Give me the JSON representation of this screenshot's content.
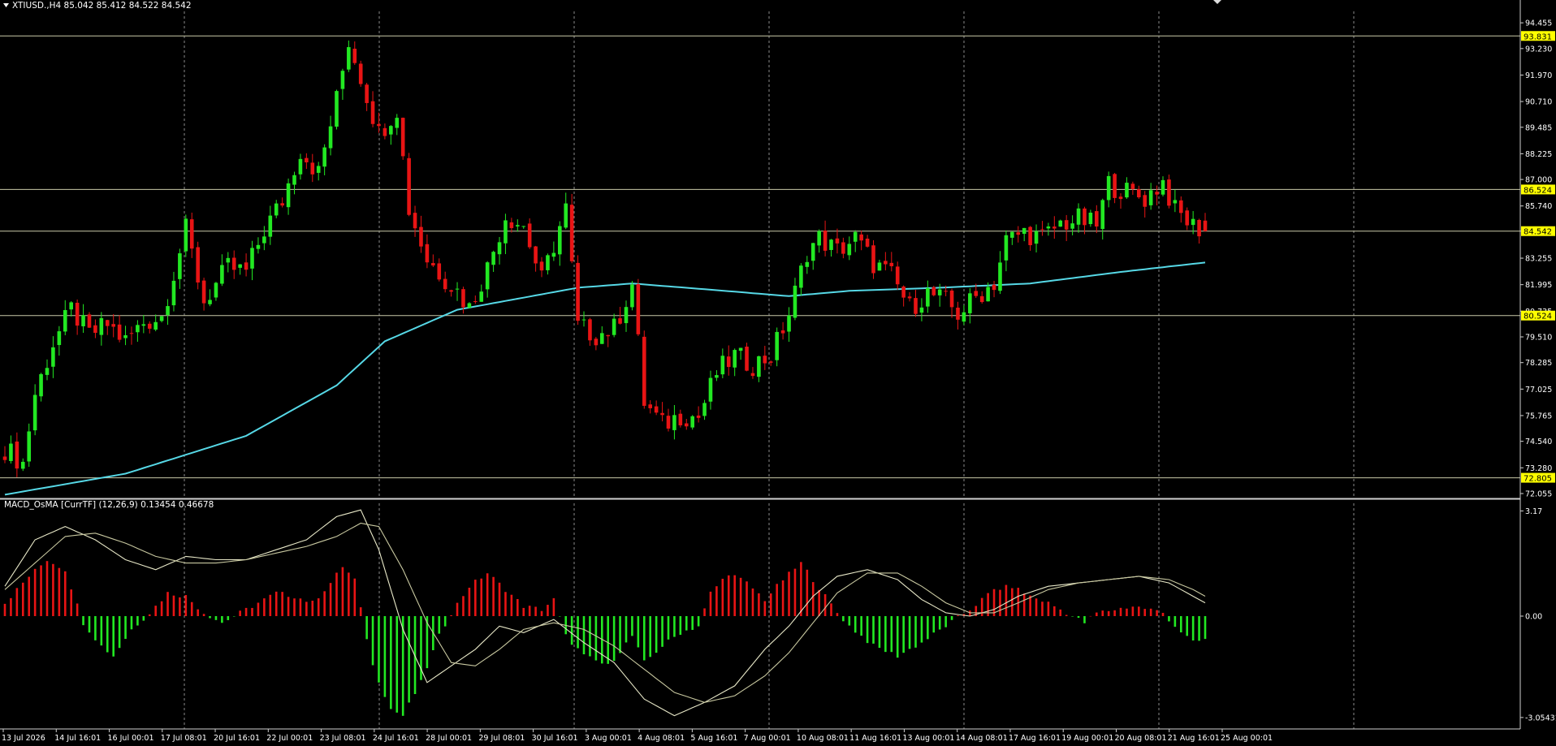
{
  "header": {
    "menu_icon": "dropdown-triangle-icon",
    "text": "XTIUSD.,H4  85.042 85.412 84.522 84.542"
  },
  "indicator": {
    "text": "MACD_OsMA [CurrTF] (12,26,9) 0.13454 0.46678"
  },
  "colors": {
    "background": "#000000",
    "bull": "#22e822",
    "bear": "#e81414",
    "ma": "#56d8e6",
    "hline": "#c9c9a8",
    "tag_bg": "#ffff00",
    "grid": "#8a8a8a",
    "macd_line": "#e8e8c8",
    "signal_line": "#c8c8a0"
  },
  "chart_data": [
    {
      "type": "candlestick",
      "symbol": "XTIUSD.",
      "timeframe": "H4",
      "ohlc_last": {
        "open": 85.042,
        "high": 85.412,
        "low": 84.522,
        "close": 84.542
      },
      "y_ticks": [
        "94.455",
        "93.230",
        "91.970",
        "90.710",
        "89.485",
        "88.225",
        "87.000",
        "85.740",
        "84.542",
        "83.255",
        "81.995",
        "80.735",
        "79.510",
        "78.285",
        "77.025",
        "75.765",
        "74.540",
        "73.280",
        "72.055"
      ],
      "ylim": [
        71.9,
        95.0
      ],
      "x_tick_labels": [
        "13 Jul 2026",
        "14 Jul 16:01",
        "16 Jul 00:01",
        "17 Jul 08:01",
        "20 Jul 16:01",
        "22 Jul 00:01",
        "23 Jul 08:01",
        "24 Jul 16:01",
        "28 Jul 00:01",
        "29 Jul 08:01",
        "30 Jul 16:01",
        "3 Aug 00:01",
        "4 Aug 08:01",
        "5 Aug 16:01",
        "7 Aug 00:01",
        "10 Aug 08:01",
        "11 Aug 16:01",
        "13 Aug 00:01",
        "14 Aug 08:01",
        "17 Aug 16:01",
        "19 Aug 00:01",
        "20 Aug 08:01",
        "21 Aug 16:01",
        "25 Aug 00:01"
      ],
      "horizontal_levels": [
        {
          "value": 93.831,
          "label": "93.831"
        },
        {
          "value": 86.524,
          "label": "86.524"
        },
        {
          "value": 84.542,
          "label": "84.542"
        },
        {
          "value": 80.524,
          "label": "80.524"
        },
        {
          "value": 72.805,
          "label": "72.805"
        }
      ],
      "close_path": [
        [
          0,
          74.2
        ],
        [
          3,
          73.5
        ],
        [
          5,
          76.8
        ],
        [
          8,
          79.2
        ],
        [
          11,
          80.8
        ],
        [
          14,
          79.6
        ],
        [
          17,
          80.1
        ],
        [
          20,
          79.3
        ],
        [
          23,
          80.2
        ],
        [
          26,
          80.5
        ],
        [
          30,
          84.6
        ],
        [
          33,
          81.2
        ],
        [
          37,
          82.8
        ],
        [
          40,
          82.6
        ],
        [
          43,
          84.6
        ],
        [
          46,
          86.0
        ],
        [
          49,
          88.4
        ],
        [
          52,
          87.3
        ],
        [
          55,
          90.8
        ],
        [
          57,
          93.6
        ],
        [
          59,
          91.9
        ],
        [
          62,
          89.2
        ],
        [
          65,
          90.4
        ],
        [
          67,
          85.6
        ],
        [
          70,
          83.2
        ],
        [
          73,
          82.3
        ],
        [
          75,
          81.7
        ],
        [
          77,
          80.9
        ],
        [
          80,
          82.8
        ],
        [
          83,
          85.3
        ],
        [
          86,
          84.8
        ],
        [
          89,
          82.2
        ],
        [
          93,
          85.6
        ],
        [
          95,
          80.0
        ],
        [
          98,
          79.6
        ],
        [
          101,
          79.9
        ],
        [
          104,
          82.0
        ],
        [
          106,
          76.4
        ],
        [
          109,
          75.3
        ],
        [
          112,
          75.8
        ],
        [
          115,
          75.7
        ],
        [
          118,
          77.8
        ],
        [
          121,
          78.6
        ],
        [
          124,
          78.2
        ],
        [
          127,
          78.6
        ],
        [
          130,
          80.6
        ],
        [
          133,
          83.6
        ],
        [
          135,
          84.2
        ],
        [
          138,
          83.6
        ],
        [
          141,
          84.2
        ],
        [
          144,
          83.0
        ],
        [
          147,
          82.4
        ],
        [
          150,
          80.9
        ],
        [
          153,
          81.6
        ],
        [
          156,
          81.2
        ],
        [
          158,
          80.6
        ],
        [
          161,
          81.4
        ],
        [
          164,
          82.1
        ],
        [
          166,
          84.1
        ],
        [
          169,
          84.5
        ],
        [
          172,
          84.2
        ],
        [
          175,
          84.9
        ],
        [
          178,
          85.1
        ],
        [
          181,
          84.8
        ],
        [
          183,
          86.8
        ],
        [
          186,
          86.4
        ],
        [
          189,
          86.1
        ],
        [
          192,
          86.9
        ],
        [
          194,
          85.5
        ],
        [
          197,
          84.8
        ],
        [
          199,
          84.542
        ]
      ],
      "ma_path": [
        [
          0,
          72.0
        ],
        [
          20,
          73.0
        ],
        [
          40,
          74.8
        ],
        [
          55,
          77.2
        ],
        [
          63,
          79.3
        ],
        [
          75,
          80.8
        ],
        [
          95,
          81.85
        ],
        [
          104,
          82.05
        ],
        [
          115,
          81.8
        ],
        [
          130,
          81.45
        ],
        [
          140,
          81.7
        ],
        [
          155,
          81.85
        ],
        [
          170,
          82.05
        ],
        [
          185,
          82.6
        ],
        [
          199,
          83.05
        ]
      ]
    },
    {
      "type": "bar",
      "name": "MACD_OsMA [CurrTF] (12,26,9)",
      "values_last": [
        0.13454,
        0.46678
      ],
      "y_ticks": [
        "3.17",
        "0.00",
        "-3.05431"
      ],
      "ylim": [
        -3.4,
        3.4
      ],
      "histogram_path": [
        [
          0,
          0.4
        ],
        [
          4,
          1.2
        ],
        [
          7,
          1.7
        ],
        [
          10,
          1.4
        ],
        [
          13,
          -0.2
        ],
        [
          16,
          -0.9
        ],
        [
          18,
          -1.2
        ],
        [
          21,
          -0.4
        ],
        [
          24,
          0.1
        ],
        [
          27,
          0.7
        ],
        [
          30,
          0.6
        ],
        [
          33,
          0.1
        ],
        [
          36,
          -0.2
        ],
        [
          39,
          0.1
        ],
        [
          42,
          0.4
        ],
        [
          45,
          0.7
        ],
        [
          48,
          0.6
        ],
        [
          51,
          0.4
        ],
        [
          54,
          1.0
        ],
        [
          56,
          1.5
        ],
        [
          58,
          1.1
        ],
        [
          59,
          0.2
        ],
        [
          61,
          -1.5
        ],
        [
          64,
          -2.8
        ],
        [
          66,
          -3.0
        ],
        [
          69,
          -2.0
        ],
        [
          72,
          -0.6
        ],
        [
          74,
          0.1
        ],
        [
          77,
          0.9
        ],
        [
          80,
          1.3
        ],
        [
          83,
          0.8
        ],
        [
          86,
          0.3
        ],
        [
          89,
          0.2
        ],
        [
          91,
          0.5
        ],
        [
          93,
          -0.6
        ],
        [
          96,
          -1.2
        ],
        [
          100,
          -1.5
        ],
        [
          104,
          -0.6
        ],
        [
          106,
          -1.4
        ],
        [
          109,
          -0.9
        ],
        [
          112,
          -0.5
        ],
        [
          115,
          -0.3
        ],
        [
          117,
          0.7
        ],
        [
          120,
          1.3
        ],
        [
          123,
          1.0
        ],
        [
          126,
          0.5
        ],
        [
          129,
          1.1
        ],
        [
          132,
          1.6
        ],
        [
          134,
          1.1
        ],
        [
          136,
          0.6
        ],
        [
          138,
          0.1
        ],
        [
          140,
          -0.3
        ],
        [
          144,
          -0.9
        ],
        [
          148,
          -1.2
        ],
        [
          152,
          -0.8
        ],
        [
          156,
          -0.3
        ],
        [
          160,
          0.2
        ],
        [
          164,
          0.8
        ],
        [
          167,
          0.9
        ],
        [
          170,
          0.6
        ],
        [
          173,
          0.4
        ],
        [
          176,
          0.1
        ],
        [
          179,
          -0.2
        ],
        [
          181,
          0.1
        ],
        [
          184,
          0.2
        ],
        [
          187,
          0.3
        ],
        [
          190,
          0.2
        ],
        [
          192,
          0.1
        ],
        [
          194,
          -0.3
        ],
        [
          197,
          -0.8
        ],
        [
          199,
          -0.7
        ]
      ],
      "macd_line_path": [
        [
          0,
          0.9
        ],
        [
          5,
          2.3
        ],
        [
          10,
          2.7
        ],
        [
          15,
          2.3
        ],
        [
          20,
          1.7
        ],
        [
          25,
          1.4
        ],
        [
          30,
          1.8
        ],
        [
          35,
          1.7
        ],
        [
          40,
          1.7
        ],
        [
          45,
          2.0
        ],
        [
          50,
          2.3
        ],
        [
          55,
          3.0
        ],
        [
          59,
          3.2
        ],
        [
          62,
          2.0
        ],
        [
          66,
          -0.4
        ],
        [
          70,
          -2.0
        ],
        [
          74,
          -1.5
        ],
        [
          78,
          -1.0
        ],
        [
          82,
          -0.3
        ],
        [
          86,
          -0.5
        ],
        [
          91,
          -0.1
        ],
        [
          96,
          -0.8
        ],
        [
          101,
          -1.4
        ],
        [
          106,
          -2.5
        ],
        [
          111,
          -3.0
        ],
        [
          116,
          -2.6
        ],
        [
          121,
          -2.1
        ],
        [
          126,
          -1.0
        ],
        [
          130,
          -0.3
        ],
        [
          134,
          0.6
        ],
        [
          138,
          1.2
        ],
        [
          143,
          1.4
        ],
        [
          148,
          1.1
        ],
        [
          152,
          0.5
        ],
        [
          156,
          0.1
        ],
        [
          160,
          0.0
        ],
        [
          164,
          0.2
        ],
        [
          168,
          0.6
        ],
        [
          173,
          0.9
        ],
        [
          178,
          1.0
        ],
        [
          183,
          1.1
        ],
        [
          188,
          1.2
        ],
        [
          193,
          1.0
        ],
        [
          197,
          0.6
        ],
        [
          199,
          0.4
        ]
      ],
      "signal_line_path": [
        [
          0,
          0.8
        ],
        [
          5,
          1.6
        ],
        [
          10,
          2.4
        ],
        [
          15,
          2.5
        ],
        [
          20,
          2.2
        ],
        [
          25,
          1.8
        ],
        [
          30,
          1.6
        ],
        [
          35,
          1.6
        ],
        [
          40,
          1.7
        ],
        [
          45,
          1.9
        ],
        [
          50,
          2.1
        ],
        [
          55,
          2.4
        ],
        [
          59,
          2.8
        ],
        [
          62,
          2.7
        ],
        [
          66,
          1.4
        ],
        [
          70,
          -0.2
        ],
        [
          74,
          -1.4
        ],
        [
          78,
          -1.5
        ],
        [
          82,
          -1.0
        ],
        [
          86,
          -0.4
        ],
        [
          91,
          -0.2
        ],
        [
          96,
          -0.4
        ],
        [
          101,
          -0.9
        ],
        [
          106,
          -1.6
        ],
        [
          111,
          -2.3
        ],
        [
          116,
          -2.6
        ],
        [
          121,
          -2.4
        ],
        [
          126,
          -1.8
        ],
        [
          130,
          -1.1
        ],
        [
          134,
          -0.2
        ],
        [
          138,
          0.7
        ],
        [
          143,
          1.3
        ],
        [
          148,
          1.3
        ],
        [
          152,
          0.9
        ],
        [
          156,
          0.4
        ],
        [
          160,
          0.1
        ],
        [
          164,
          0.1
        ],
        [
          168,
          0.4
        ],
        [
          173,
          0.8
        ],
        [
          178,
          1.0
        ],
        [
          183,
          1.1
        ],
        [
          188,
          1.2
        ],
        [
          193,
          1.1
        ],
        [
          197,
          0.8
        ],
        [
          199,
          0.6
        ]
      ]
    }
  ]
}
